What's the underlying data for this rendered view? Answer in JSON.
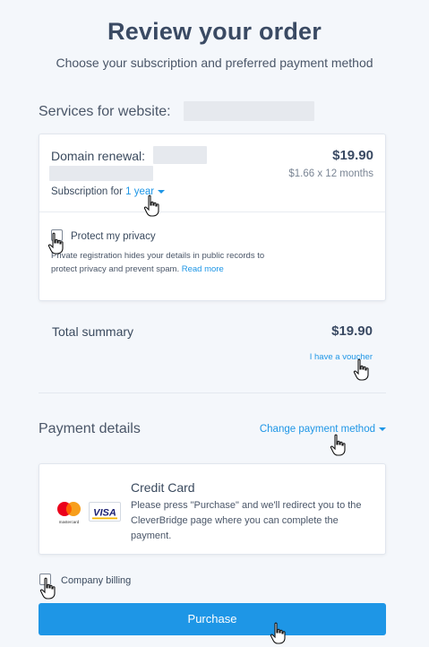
{
  "header": {
    "title": "Review your order",
    "subtitle": "Choose your subscription and preferred payment method"
  },
  "services": {
    "label": "Services for website:"
  },
  "domain_item": {
    "label": "Domain renewal:",
    "price": "$19.90",
    "price_detail": "$1.66 x 12 months",
    "subscription_prefix": "Subscription for",
    "subscription_value": "1 year"
  },
  "privacy": {
    "label": "Protect my privacy",
    "description": "Private registration hides your details in public records to protect privacy and prevent spam.",
    "read_more": "Read more",
    "checked": false
  },
  "summary": {
    "label": "Total summary",
    "total": "$19.90",
    "voucher_link": "I have a voucher"
  },
  "payment": {
    "label": "Payment details",
    "change_method": "Change payment method",
    "method_title": "Credit Card",
    "method_description": "Please press \"Purchase\" and we'll redirect you to the CleverBridge page where you can complete the payment.",
    "mastercard_text": "mastercard",
    "visa_text": "VISA"
  },
  "company_billing": {
    "label": "Company billing",
    "checked": false
  },
  "purchase_button": {
    "label": "Purchase"
  },
  "colors": {
    "accent": "#1e96e6",
    "heading": "#3a4a63",
    "background": "#f4f7fb"
  }
}
